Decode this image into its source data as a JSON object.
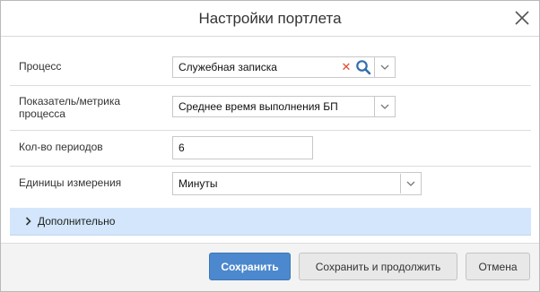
{
  "dialog": {
    "title": "Настройки портлета"
  },
  "form": {
    "process": {
      "label": "Процесс",
      "value": "Служебная записка"
    },
    "metric": {
      "label": "Показатель/метрика процесса",
      "value": "Среднее время выполнения БП"
    },
    "periods": {
      "label": "Кол-во периодов",
      "value": "6"
    },
    "units": {
      "label": "Единицы измерения",
      "value": "Минуты"
    }
  },
  "additional": {
    "label": "Дополнительно"
  },
  "footer": {
    "save_label": "Сохранить",
    "save_continue_label": "Сохранить и продолжить",
    "cancel_label": "Отмена"
  },
  "colors": {
    "primary": "#4c88cd",
    "clear_icon": "#e04a2a",
    "search_icon": "#2f6fae",
    "section_bg": "#d3e6fb"
  },
  "icons": [
    "close-icon",
    "clear-icon",
    "search-icon",
    "chevron-down-icon",
    "chevron-right-icon"
  ]
}
